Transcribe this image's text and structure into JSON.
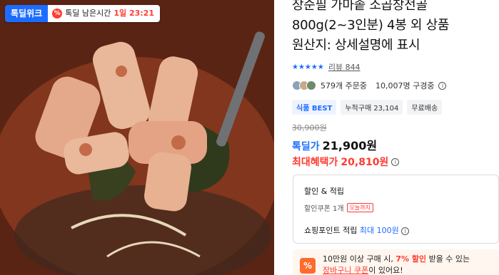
{
  "photo_badges": {
    "brand": "톡딜위크",
    "timer_icon": "%",
    "timer_label": "톡딜 남은시간",
    "timer_value": "1일 23:21"
  },
  "product": {
    "title_line1": "장순필 가마솥 소곱창전골",
    "title_line2": "800g(2~3인분) 4봉 외 상품",
    "title_line3": "원산지: 상세설명에 표시",
    "stars": "★★★★★",
    "review_label": "리뷰 844",
    "order_count": "579개 주문중",
    "subscriber_count": "10,007명 구경중",
    "info_icon": "i"
  },
  "tags": [
    "식품 BEST",
    "누적구매 23,104",
    "무료배송"
  ],
  "price": {
    "original": "30,900원",
    "label": "톡딜가",
    "value": "21,900원",
    "max_label": "최대혜택가",
    "max_value": "20,810원",
    "info_icon": "i"
  },
  "benefits": {
    "title": "할인 & 적립",
    "coupon_text": "할인쿠폰 1개",
    "coupon_chip": "오늘까지",
    "points_text": "쇼핑포인트 적립",
    "points_value": "최대 100원",
    "info_icon": "i"
  },
  "promo": {
    "icon": "%",
    "line1_prefix": "10만원 이상 구매 시, ",
    "line1_red": "7% 할인",
    "line1_suffix": " 받을 수 있는",
    "line2_link": "장바구니 쿠폰",
    "line2_suffix": "이 있어요!"
  },
  "colors": {
    "accent_blue": "#1c6dff",
    "accent_red": "#ff3b30",
    "promo_orange": "#ff6b2c"
  }
}
